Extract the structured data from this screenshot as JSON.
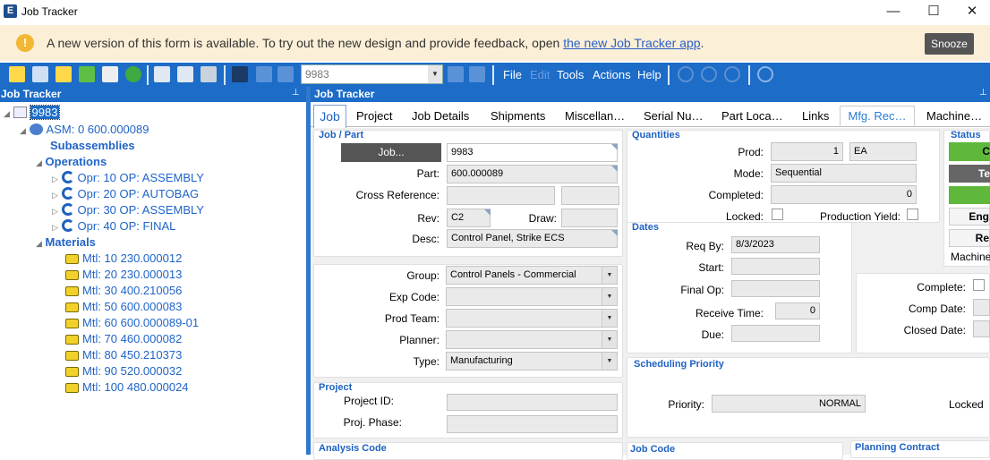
{
  "window": {
    "title": "Job Tracker",
    "minimize": "—",
    "maximize": "☐",
    "close": "✕"
  },
  "banner": {
    "icon": "!",
    "text": "A new version of this form is available. To try out the new design and provide feedback, open ",
    "link": "the new Job Tracker app",
    "suffix": ".",
    "snooze": "Snooze"
  },
  "toolbar": {
    "job_combo_value": "9983",
    "menus": [
      "File",
      "Edit",
      "Tools",
      "Actions",
      "Help"
    ]
  },
  "left_panel": {
    "title": "Job Tracker",
    "tree": {
      "root": "9983",
      "assembly": "ASM: 0 600.000089",
      "subassemblies": "Subassemblies",
      "operations_label": "Operations",
      "operations": [
        "Opr: 10 OP: ASSEMBLY",
        "Opr: 20 OP: AUTOBAG",
        "Opr: 30 OP: ASSEMBLY",
        "Opr: 40 OP: FINAL"
      ],
      "materials_label": "Materials",
      "materials": [
        "Mtl: 10 230.000012",
        "Mtl: 20 230.000013",
        "Mtl: 30 400.210056",
        "Mtl: 50 600.000083",
        "Mtl: 60 600.000089-01",
        "Mtl: 70 460.000082",
        "Mtl: 80 450.210373",
        "Mtl: 90 520.000032",
        "Mtl: 100 480.000024"
      ]
    }
  },
  "right_panel": {
    "title": "Job Tracker",
    "tabs": [
      "Job",
      "Project",
      "Job Details",
      "Shipments",
      "Miscellan…",
      "Serial Nu…",
      "Part Loca…",
      "Links",
      "Mfg. Rec…",
      "Machine…"
    ]
  },
  "job_part": {
    "title": "Job / Part",
    "job_button": "Job...",
    "job_value": "9983",
    "part_label": "Part:",
    "part_value": "600.000089",
    "crossref_label": "Cross Reference:",
    "rev_label": "Rev:",
    "rev_value": "C2",
    "draw_label": "Draw:",
    "desc_label": "Desc:",
    "desc_value": "Control Panel, Strike ECS"
  },
  "group_section": {
    "group_label": "Group:",
    "group_value": "Control Panels - Commercial",
    "expcode_label": "Exp Code:",
    "prodteam_label": "Prod Team:",
    "planner_label": "Planner:",
    "type_label": "Type:",
    "type_value": "Manufacturing"
  },
  "project": {
    "title": "Project",
    "id_label": "Project ID:",
    "phase_label": "Proj. Phase:"
  },
  "analysis": {
    "title": "Analysis Code"
  },
  "quantities": {
    "title": "Quantities",
    "prod_label": "Prod:",
    "prod_value": "1",
    "prod_uom": "EA",
    "mode_label": "Mode:",
    "mode_value": "Sequential",
    "completed_label": "Completed:",
    "completed_value": "0",
    "locked_label": "Locked:",
    "yield_label": "Production Yield:"
  },
  "dates": {
    "title": "Dates",
    "reqby_label": "Req By:",
    "reqby_value": "8/3/2023",
    "start_label": "Start:",
    "finalop_label": "Final Op:",
    "receive_label": "Receive Time:",
    "receive_value": "0",
    "due_label": "Due:"
  },
  "status": {
    "title": "Status",
    "btn1": "C",
    "btn2": "Te",
    "btn3": "",
    "engineered": "Eng",
    "released": "Re",
    "machine": "Machine"
  },
  "completion": {
    "complete_label": "Complete:",
    "comp_date_label": "Comp Date:",
    "closed_date_label": "Closed Date:"
  },
  "scheduling": {
    "title": "Scheduling Priority",
    "priority_label": "Priority:",
    "priority_value": "NORMAL",
    "locked_label": "Locked"
  },
  "job_code": {
    "title": "Job Code"
  },
  "planning_contract": {
    "title": "Planning Contract"
  },
  "colors": {
    "accent": "#1c6cc8",
    "banner": "#fcefd7",
    "link": "#2b61c7",
    "green": "#5fb83c"
  }
}
